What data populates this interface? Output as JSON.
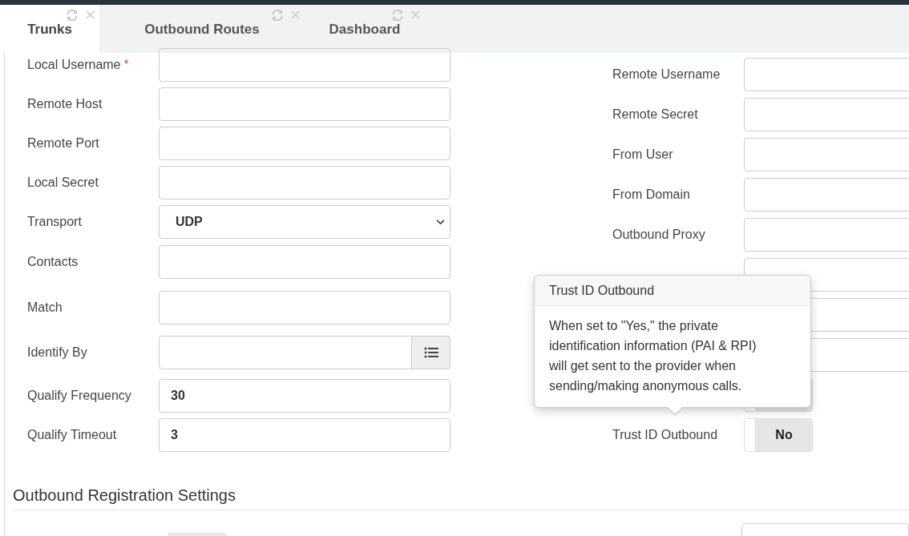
{
  "tabs": [
    {
      "label": "Trunks",
      "selected": true
    },
    {
      "label": "Outbound Routes",
      "selected": false
    },
    {
      "label": "Dashboard",
      "selected": false
    }
  ],
  "left_fields": [
    {
      "kind": "text",
      "label": "Local Username",
      "required_mark": "*"
    },
    {
      "kind": "text",
      "label": "Remote Host"
    },
    {
      "kind": "text",
      "label": "Remote Port"
    },
    {
      "kind": "text",
      "label": "Local Secret"
    },
    {
      "kind": "select",
      "label": "Transport",
      "value": "UDP"
    },
    {
      "kind": "text",
      "label": "Contacts"
    },
    {
      "kind": "text",
      "label": "Match"
    },
    {
      "kind": "picker",
      "label": "Identify By"
    },
    {
      "kind": "text",
      "label": "Qualify Frequency",
      "value": "30"
    },
    {
      "kind": "text",
      "label": "Qualify Timeout",
      "value": "3"
    }
  ],
  "right_fields": [
    {
      "kind": "text",
      "label": "Remote Username"
    },
    {
      "kind": "text",
      "label": "Remote Secret"
    },
    {
      "kind": "text",
      "label": "From User"
    },
    {
      "kind": "text",
      "label": "From Domain"
    },
    {
      "kind": "text",
      "label": "Outbound Proxy"
    },
    {
      "kind": "text"
    },
    {
      "kind": "text"
    },
    {
      "kind": "text"
    },
    {
      "kind": "toggle",
      "on": false
    },
    {
      "kind": "toggle",
      "label": "Trust ID Outbound",
      "on": false,
      "value": "No"
    }
  ],
  "tooltip": {
    "title": "Trust ID Outbound",
    "body": "When set to \"Yes,\" the private identification information (PAI & RPI) will get sent to the provider when sending/making anonymous calls."
  },
  "section_title": "Outbound Registration Settings",
  "next_row": {
    "toggle_on": false
  }
}
